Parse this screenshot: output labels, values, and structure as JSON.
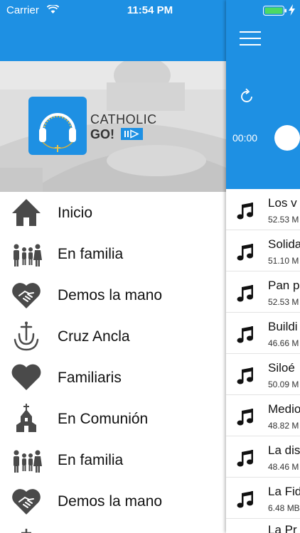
{
  "status_bar": {
    "carrier": "Carrier",
    "time": "11:54 PM"
  },
  "brand": {
    "line1": "CATHOLIC",
    "line2": "GO!"
  },
  "menu": [
    {
      "label": "Inicio",
      "icon": "house-icon"
    },
    {
      "label": "En familia",
      "icon": "family-icon"
    },
    {
      "label": "Demos la mano",
      "icon": "heart-handshake-icon"
    },
    {
      "label": "Cruz Ancla",
      "icon": "anchor-cross-icon"
    },
    {
      "label": "Familiaris",
      "icon": "heart-icon"
    },
    {
      "label": "En Comunión",
      "icon": "church-icon"
    },
    {
      "label": "En familia",
      "icon": "family-icon"
    },
    {
      "label": "Demos la mano",
      "icon": "heart-handshake-icon"
    }
  ],
  "player": {
    "elapsed": "00:00"
  },
  "tracks": [
    {
      "title": "Los v",
      "size": "52.53 M"
    },
    {
      "title": "Solida",
      "size": "51.10 M"
    },
    {
      "title": "Pan p",
      "size": "52.53 M"
    },
    {
      "title": "Buildi",
      "size": "46.66 M"
    },
    {
      "title": "Siloé",
      "size": "50.09 M"
    },
    {
      "title": "Medio",
      "size": "48.82 M"
    },
    {
      "title": "La dis",
      "size": "48.46 M"
    },
    {
      "title": "La Fid",
      "size": "6.48 MB"
    },
    {
      "title": "La Pr",
      "size": ""
    }
  ],
  "colors": {
    "accent": "#1e90e3",
    "icon_gray": "#4a4a4a"
  }
}
